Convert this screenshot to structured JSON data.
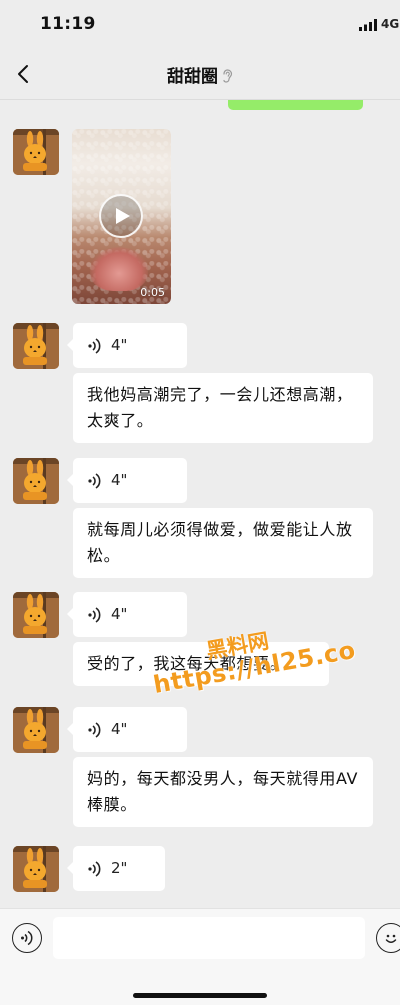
{
  "status_bar": {
    "time": "11:19",
    "network": "4G"
  },
  "nav": {
    "title": "甜甜圈",
    "back_icon": "chevron-left-icon",
    "mute_icon": "ear-icon"
  },
  "messages": [
    {
      "type": "video",
      "duration": "0:05"
    },
    {
      "type": "voice",
      "duration": "4\""
    },
    {
      "type": "text",
      "text": "我他妈高潮完了，一会儿还想高潮，太爽了。"
    },
    {
      "type": "voice",
      "duration": "4\""
    },
    {
      "type": "text",
      "text": "就每周儿必须得做爱，做爱能让人放松。"
    },
    {
      "type": "voice",
      "duration": "4\""
    },
    {
      "type": "text",
      "text": "受的了，我这每天都想要。"
    },
    {
      "type": "voice",
      "duration": "4\""
    },
    {
      "type": "text",
      "text": "妈的，每天都没男人，每天就得用AV棒膜。"
    },
    {
      "type": "voice",
      "duration": "2\""
    }
  ],
  "watermark": {
    "name": "黑料网",
    "url": "https://hl25.co"
  },
  "input_bar": {
    "placeholder": "",
    "left_icon": "voice-mode-icon",
    "right_icon": "emoji-icon"
  },
  "colors": {
    "background": "#ededed",
    "sent_bubble": "#95ec69",
    "received_bubble": "#ffffff",
    "watermark": "#f39c1f"
  }
}
